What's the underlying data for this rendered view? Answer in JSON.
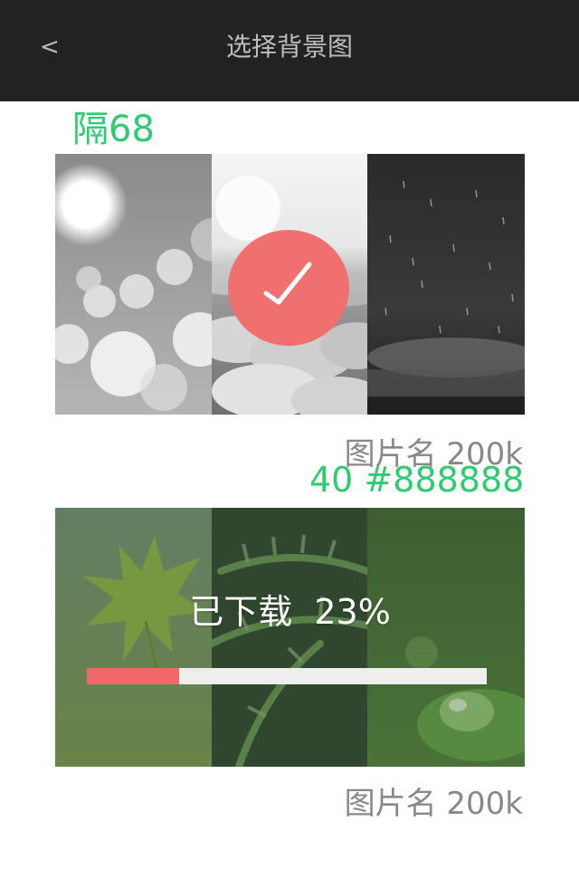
{
  "header": {
    "back_label": "<",
    "title": "选择背景图"
  },
  "annotations": {
    "top_label": "隔68",
    "mid_label": "40  #888888",
    "color": "#2ecc71"
  },
  "wallpapers": [
    {
      "thumbnails": [
        "bokeh-gray",
        "clouds-gray",
        "rain-dark"
      ],
      "selected": true,
      "check_icon": "checkmark-icon",
      "caption": "图片名 200k"
    },
    {
      "thumbnails": [
        "maple-leaf-green",
        "fern-green",
        "water-drop-green"
      ],
      "downloading": true,
      "download_text": "已下载  23%",
      "progress": 0.23,
      "progress_color": "#f36868",
      "caption": "图片名 200k"
    }
  ],
  "colors": {
    "topbar": "#222222",
    "caption": "#888888",
    "selected_badge": "#f07070"
  }
}
